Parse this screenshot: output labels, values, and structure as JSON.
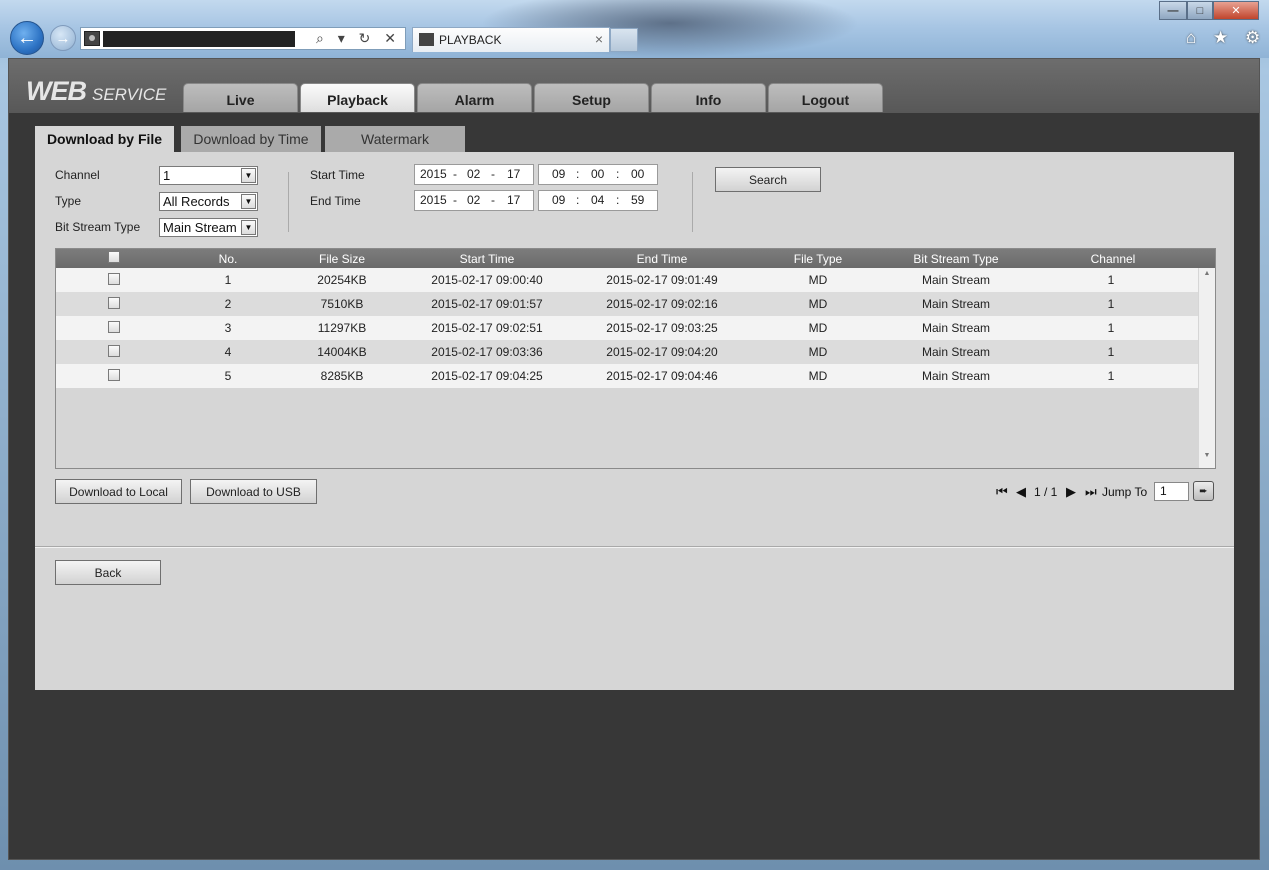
{
  "browser": {
    "tab_title": "PLAYBACK",
    "address_icons": "⌕ ▾ ↻ ✕",
    "tools_icons": "⌂ ★ ⚙"
  },
  "app": {
    "logo_web": "WEB",
    "logo_service": "SERVICE",
    "main_tabs": [
      "Live",
      "Playback",
      "Alarm",
      "Setup",
      "Info",
      "Logout"
    ],
    "active_main_tab": "Playback"
  },
  "sub_tabs": [
    "Download by File",
    "Download by Time",
    "Watermark"
  ],
  "filters": {
    "channel_label": "Channel",
    "channel_value": "1",
    "type_label": "Type",
    "type_value": "All Records",
    "bitstream_label": "Bit Stream Type",
    "bitstream_value": "Main Stream",
    "start_label": "Start Time",
    "end_label": "End Time",
    "start_date": {
      "y": "2015",
      "m": "02",
      "d": "17"
    },
    "start_time": {
      "h": "09",
      "m": "00",
      "s": "00"
    },
    "end_date": {
      "y": "2015",
      "m": "02",
      "d": "17"
    },
    "end_time": {
      "h": "09",
      "m": "04",
      "s": "59"
    },
    "date_sep": "-",
    "time_sep": ":",
    "search_label": "Search"
  },
  "table": {
    "headers": [
      "No.",
      "File Size",
      "Start Time",
      "End Time",
      "File Type",
      "Bit Stream Type",
      "Channel"
    ],
    "rows": [
      [
        "1",
        "20254KB",
        "2015-02-17 09:00:40",
        "2015-02-17 09:01:49",
        "MD",
        "Main Stream",
        "1"
      ],
      [
        "2",
        "7510KB",
        "2015-02-17 09:01:57",
        "2015-02-17 09:02:16",
        "MD",
        "Main Stream",
        "1"
      ],
      [
        "3",
        "11297KB",
        "2015-02-17 09:02:51",
        "2015-02-17 09:03:25",
        "MD",
        "Main Stream",
        "1"
      ],
      [
        "4",
        "14004KB",
        "2015-02-17 09:03:36",
        "2015-02-17 09:04:20",
        "MD",
        "Main Stream",
        "1"
      ],
      [
        "5",
        "8285KB",
        "2015-02-17 09:04:25",
        "2015-02-17 09:04:46",
        "MD",
        "Main Stream",
        "1"
      ]
    ]
  },
  "actions": {
    "download_local": "Download to Local",
    "download_usb": "Download to USB",
    "back": "Back"
  },
  "pager": {
    "page": "1 / 1",
    "jump_label": "Jump To",
    "jump_value": "1"
  }
}
